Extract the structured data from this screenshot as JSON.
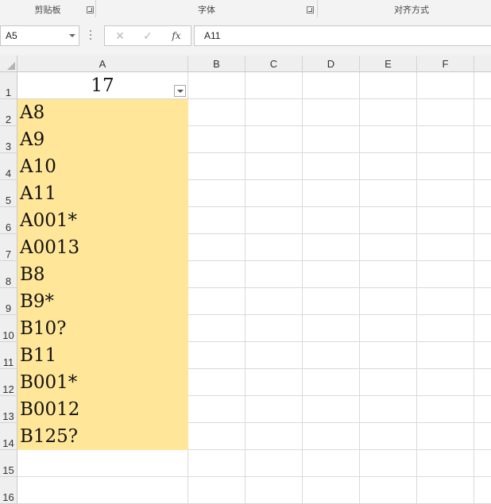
{
  "ribbon": {
    "groups": [
      {
        "label": "剪贴板",
        "has_launcher": true
      },
      {
        "label": "字体",
        "has_launcher": true
      },
      {
        "label": "对齐方式",
        "has_launcher": false
      }
    ]
  },
  "formula_bar": {
    "name_box": "A5",
    "cancel_icon": "✕",
    "enter_icon": "✓",
    "fx_label": "fx",
    "content": "A11"
  },
  "columns": [
    "A",
    "B",
    "C",
    "D",
    "E",
    "F"
  ],
  "rows": [
    "1",
    "2",
    "3",
    "4",
    "5",
    "6",
    "7",
    "8",
    "9",
    "10",
    "11",
    "12",
    "13",
    "14",
    "15",
    "16"
  ],
  "cells": {
    "A1": "17",
    "A_values": [
      "A8",
      "A9",
      "A10",
      "A11",
      "A001*",
      "A0013",
      "B8",
      "B9*",
      "B10?",
      "B11",
      "B001*",
      "B0012",
      "B125?"
    ]
  },
  "colors": {
    "fill": "#ffe699",
    "header_bg": "#efefef",
    "gridline": "#dadada"
  }
}
